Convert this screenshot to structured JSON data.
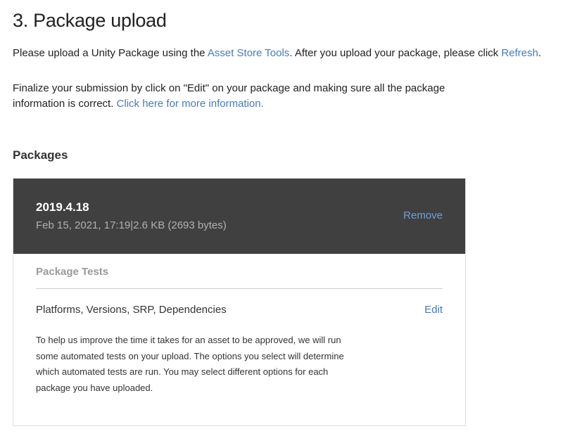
{
  "section": {
    "title": "3. Package upload",
    "para1": {
      "before": "Please upload a Unity Package using the ",
      "link1": "Asset Store Tools",
      "middle": ". After you upload your package, please click ",
      "link2": "Refresh",
      "after": "."
    },
    "para2": {
      "text": "Finalize your submission by click on \"Edit\" on your package and making sure all the package information is correct. ",
      "link": "Click here for more information."
    }
  },
  "packages": {
    "heading": "Packages",
    "items": [
      {
        "version": "2019.4.18",
        "meta": "Feb 15, 2021, 17:19|2.6 KB (2693 bytes)",
        "remove_label": "Remove",
        "tests_heading": "Package Tests",
        "tests_row_label": "Platforms, Versions, SRP, Dependencies",
        "edit_label": "Edit",
        "tests_description": "To help us improve the time it takes for an asset to be approved, we will run some automated tests on your upload. The options you select will determine which automated tests are run. You may select different options for each package you have uploaded."
      }
    ]
  },
  "colors": {
    "link": "#4a7ab5",
    "card_header": "#404040"
  }
}
